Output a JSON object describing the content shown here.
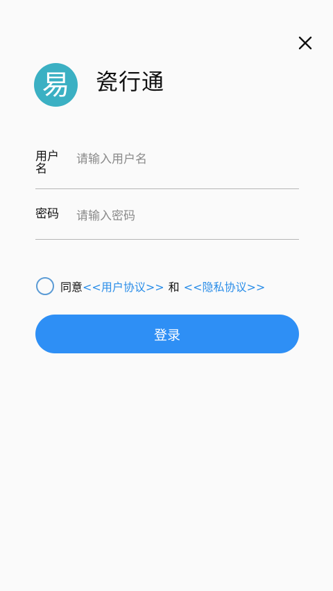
{
  "app": {
    "title": "瓷行通",
    "logo_char": "易"
  },
  "icons": {
    "close": "close-icon",
    "logo": "app-logo-icon",
    "radio": "radio-unchecked-icon"
  },
  "form": {
    "username": {
      "label": "用户名",
      "placeholder": "请输入用户名",
      "value": ""
    },
    "password": {
      "label": "密码",
      "placeholder": "请输入密码",
      "value": ""
    }
  },
  "agreement": {
    "checked": false,
    "prefix": "同意",
    "user_agreement": "<<用户协议>>",
    "and": "和",
    "privacy_policy": "<<隐私协议>>"
  },
  "actions": {
    "login_label": "登录"
  },
  "colors": {
    "background": "#fafafa",
    "logo_bg": "#3bb0c3",
    "link": "#2a8de8",
    "button": "#2e8ff5",
    "radio_border": "#5b9bd5",
    "underline": "#b5b5b5"
  }
}
